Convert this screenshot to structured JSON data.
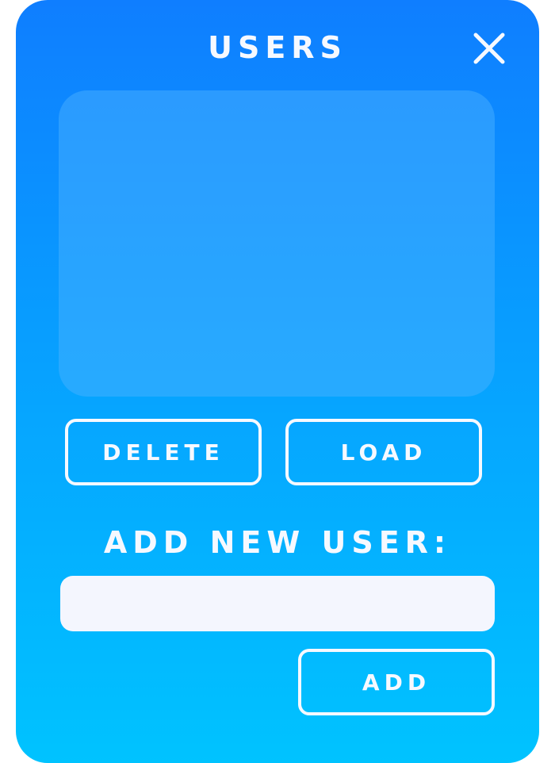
{
  "dialog": {
    "title": "USERS",
    "close_icon": "close-icon"
  },
  "user_list": {
    "items": []
  },
  "actions": {
    "delete_label": "DELETE",
    "load_label": "LOAD"
  },
  "add_user": {
    "label": "ADD NEW USER:",
    "input_value": "",
    "input_placeholder": "",
    "add_label": "ADD"
  },
  "colors": {
    "gradient_top": "#0f7eff",
    "gradient_bottom": "#00c3ff",
    "text": "#f6f9ff",
    "input_bg": "#f4f6fe"
  }
}
